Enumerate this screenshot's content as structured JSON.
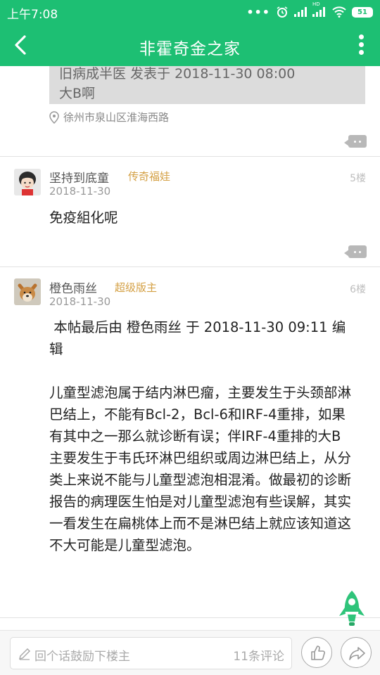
{
  "status_bar": {
    "time": "上午7:08",
    "battery": "51",
    "hd_label": "HD"
  },
  "header": {
    "title": "非霍奇金之家"
  },
  "quote": {
    "line1": "旧病成半医 发表于 2018-11-30 08:00",
    "line2": "大B啊"
  },
  "location": "徐州市泉山区淮海西路",
  "posts": [
    {
      "username": "坚持到底童",
      "badge": "传奇福娃",
      "floor": "5楼",
      "date": "2018-11-30",
      "content": "免疫組化呢"
    },
    {
      "username": "橙色雨丝",
      "badge": "超级版主",
      "floor": "6楼",
      "date": "2018-11-30",
      "edit_note": " 本帖最后由 橙色雨丝 于 2018-11-30 09:11 编辑",
      "content": "儿童型滤泡属于结内淋巴瘤，主要发生于头颈部淋巴结上，不能有Bcl-2，Bcl-6和IRF-4重排，如果有其中之一那么就诊断有误；伴IRF-4重排的大B主要发生于韦氏环淋巴组织或周边淋巴结上，从分类上来说不能与儿童型滤泡相混淆。做最初的诊断报告的病理医生怕是对儿童型滤泡有些误解，其实一看发生在扁桃体上而不是淋巴结上就应该知道这不大可能是儿童型滤泡。"
    }
  ],
  "bottom_bar": {
    "comment_placeholder": "回个话鼓励下楼主",
    "comment_count": "11条评论"
  },
  "colors": {
    "brand_green": "#1dbf73",
    "badge_gold": "#d4a044"
  },
  "icons": [
    "back-arrow-icon",
    "more-vert-icon",
    "location-pin-icon",
    "reply-icon",
    "pencil-icon",
    "thumbs-up-icon",
    "share-icon",
    "rocket-icon"
  ]
}
